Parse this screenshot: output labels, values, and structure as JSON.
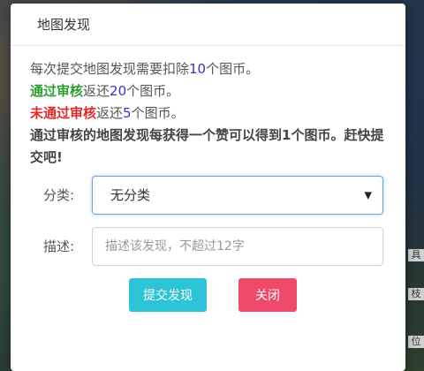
{
  "dialog": {
    "title": "地图发现"
  },
  "info": {
    "line1_prefix": "每次提交地图发现需要扣除",
    "line1_num": "10",
    "line1_suffix": "个图币。",
    "line2_highlight": "通过审核",
    "line2_mid": "返还",
    "line2_num": "20",
    "line2_suffix": "个图币。",
    "line3_highlight": "未通过审核",
    "line3_mid": "返还",
    "line3_num": "5",
    "line3_suffix": "个图币。",
    "note": "通过审核的地图发现每获得一个赞可以得到1个图币。赶快提交吧!"
  },
  "form": {
    "category_label": "分类:",
    "category_value": "无分类",
    "description_label": "描述:",
    "description_placeholder": "描述该发现，不超过12字"
  },
  "buttons": {
    "submit": "提交发现",
    "close": "关闭"
  },
  "background_tags": [
    "具",
    "枝",
    "位"
  ],
  "colors": {
    "number": "#3333cc",
    "approved": "#2e9c2e",
    "rejected": "#e02828",
    "submit_button": "#2ec4d8",
    "close_button": "#f04a6b",
    "focus_border": "#66a3e0"
  }
}
